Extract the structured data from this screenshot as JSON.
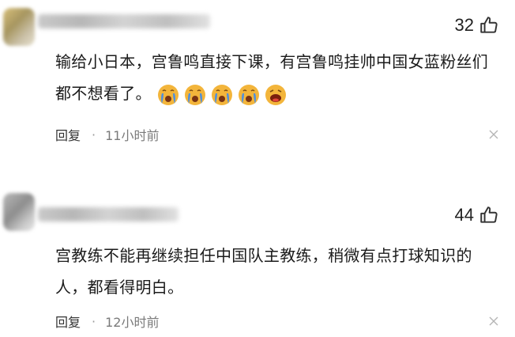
{
  "comments": [
    {
      "likes": "32",
      "text": "输给小日本，宫鲁鸣直接下课，有宫鲁鸣挂帅中国女蓝粉丝们都不想看了。",
      "emoji_names": [
        "crying-face-icon",
        "crying-face-icon",
        "crying-face-icon",
        "crying-face-icon",
        "loudly-crying-face-icon"
      ],
      "reply_label": "回复",
      "separator": "·",
      "time": "11小时前"
    },
    {
      "likes": "44",
      "text": "宫教练不能再继续担任中国队主教练，稍微有点打球知识的人，都看得明白。",
      "reply_label": "回复",
      "separator": "·",
      "time": "12小时前"
    }
  ],
  "colors": {
    "text": "#1b1b1b",
    "meta": "#7a7a7a",
    "emoji_face": "#f3b53b",
    "emoji_tear": "#4d8fe0"
  }
}
